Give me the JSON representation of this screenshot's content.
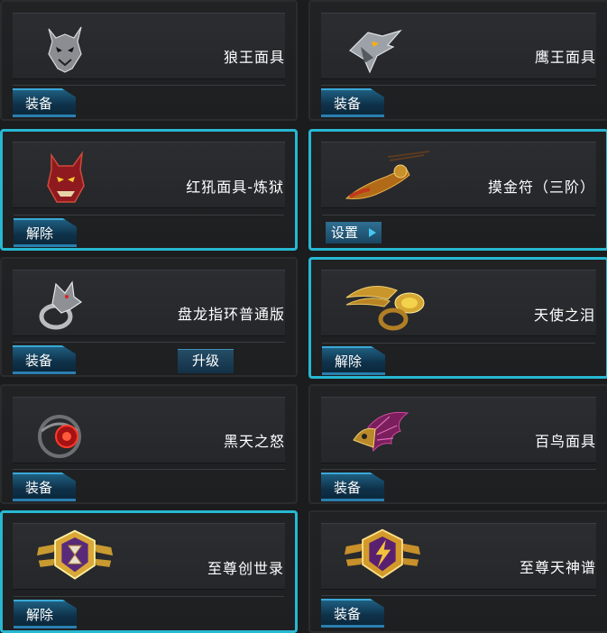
{
  "colors": {
    "accent": "#27b8d2",
    "button": "#0e3149",
    "background": "#1b1c1d"
  },
  "items": [
    {
      "name": "狼王面具",
      "action": "装备",
      "selected": false,
      "icon": "wolf-king-mask-icon"
    },
    {
      "name": "鹰王面具",
      "action": "装备",
      "selected": false,
      "icon": "eagle-king-mask-icon"
    },
    {
      "name": "红犼面具-炼狱",
      "action": "解除",
      "selected": true,
      "icon": "red-demon-mask-icon"
    },
    {
      "name": "摸金符（三阶）",
      "action": "设置",
      "selected": true,
      "icon": "amulet-icon"
    },
    {
      "name": "盘龙指环普通版",
      "action": "装备",
      "extra_action": "升级",
      "selected": false,
      "icon": "dragon-ring-icon"
    },
    {
      "name": "天使之泪",
      "action": "解除",
      "selected": true,
      "icon": "angel-tear-ring-icon"
    },
    {
      "name": "黑天之怒",
      "action": "装备",
      "selected": false,
      "icon": "black-sky-ring-icon"
    },
    {
      "name": "百鸟面具",
      "action": "装备",
      "selected": false,
      "icon": "feather-mask-icon"
    },
    {
      "name": "至尊创世录",
      "action": "解除",
      "selected": true,
      "icon": "hourglass-emblem-icon"
    },
    {
      "name": "至尊天神谱",
      "action": "装备",
      "selected": false,
      "icon": "lightning-emblem-icon"
    }
  ]
}
